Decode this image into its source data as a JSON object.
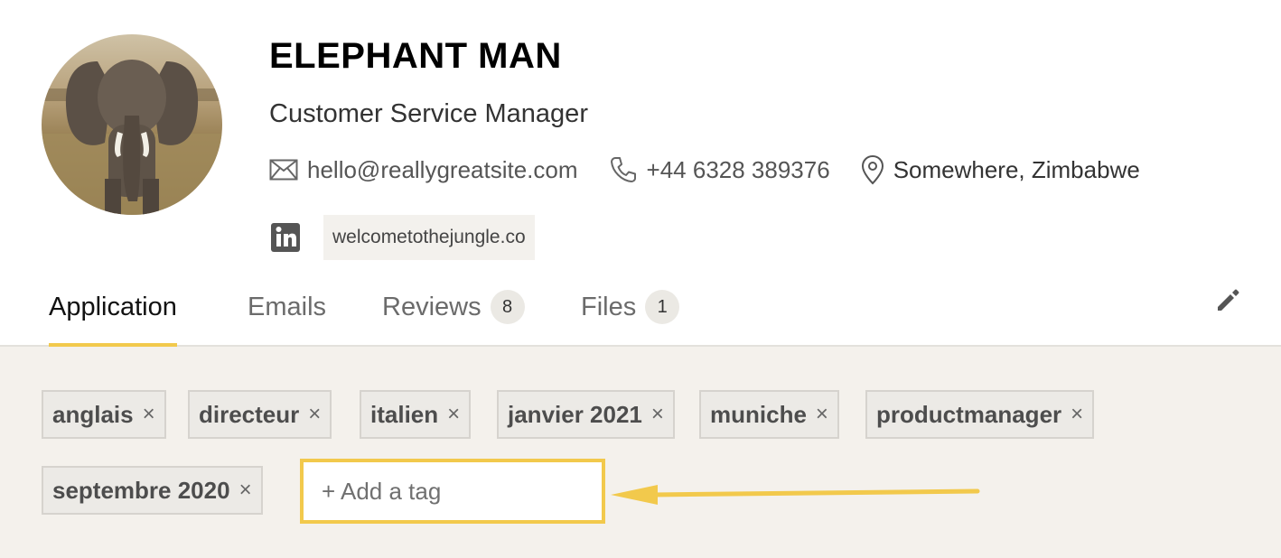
{
  "profile": {
    "name": "ELEPHANT MAN",
    "job_title": "Customer Service Manager",
    "email": "hello@reallygreatsite.com",
    "phone": "+44 6328 389376",
    "location": "Somewhere, Zimbabwe",
    "website": "welcometothejungle.co",
    "avatar_icon": "elephant-photo",
    "social_icon": "linkedin-icon"
  },
  "tabs": [
    {
      "label": "Application",
      "active": true
    },
    {
      "label": "Emails",
      "active": false
    },
    {
      "label": "Reviews",
      "count": "8",
      "active": false
    },
    {
      "label": "Files",
      "count": "1",
      "active": false
    }
  ],
  "tags": [
    "anglais",
    "directeur",
    "italien",
    "janvier 2021",
    "muniche",
    "productmanager",
    "septembre 2020"
  ],
  "tag_remove_glyph": "×",
  "tag_input": {
    "placeholder": "+ Add a tag",
    "value": ""
  },
  "colors": {
    "accent": "#f2c94c",
    "tag_area_bg": "#f4f1ec",
    "tag_bg": "#eceae6"
  }
}
